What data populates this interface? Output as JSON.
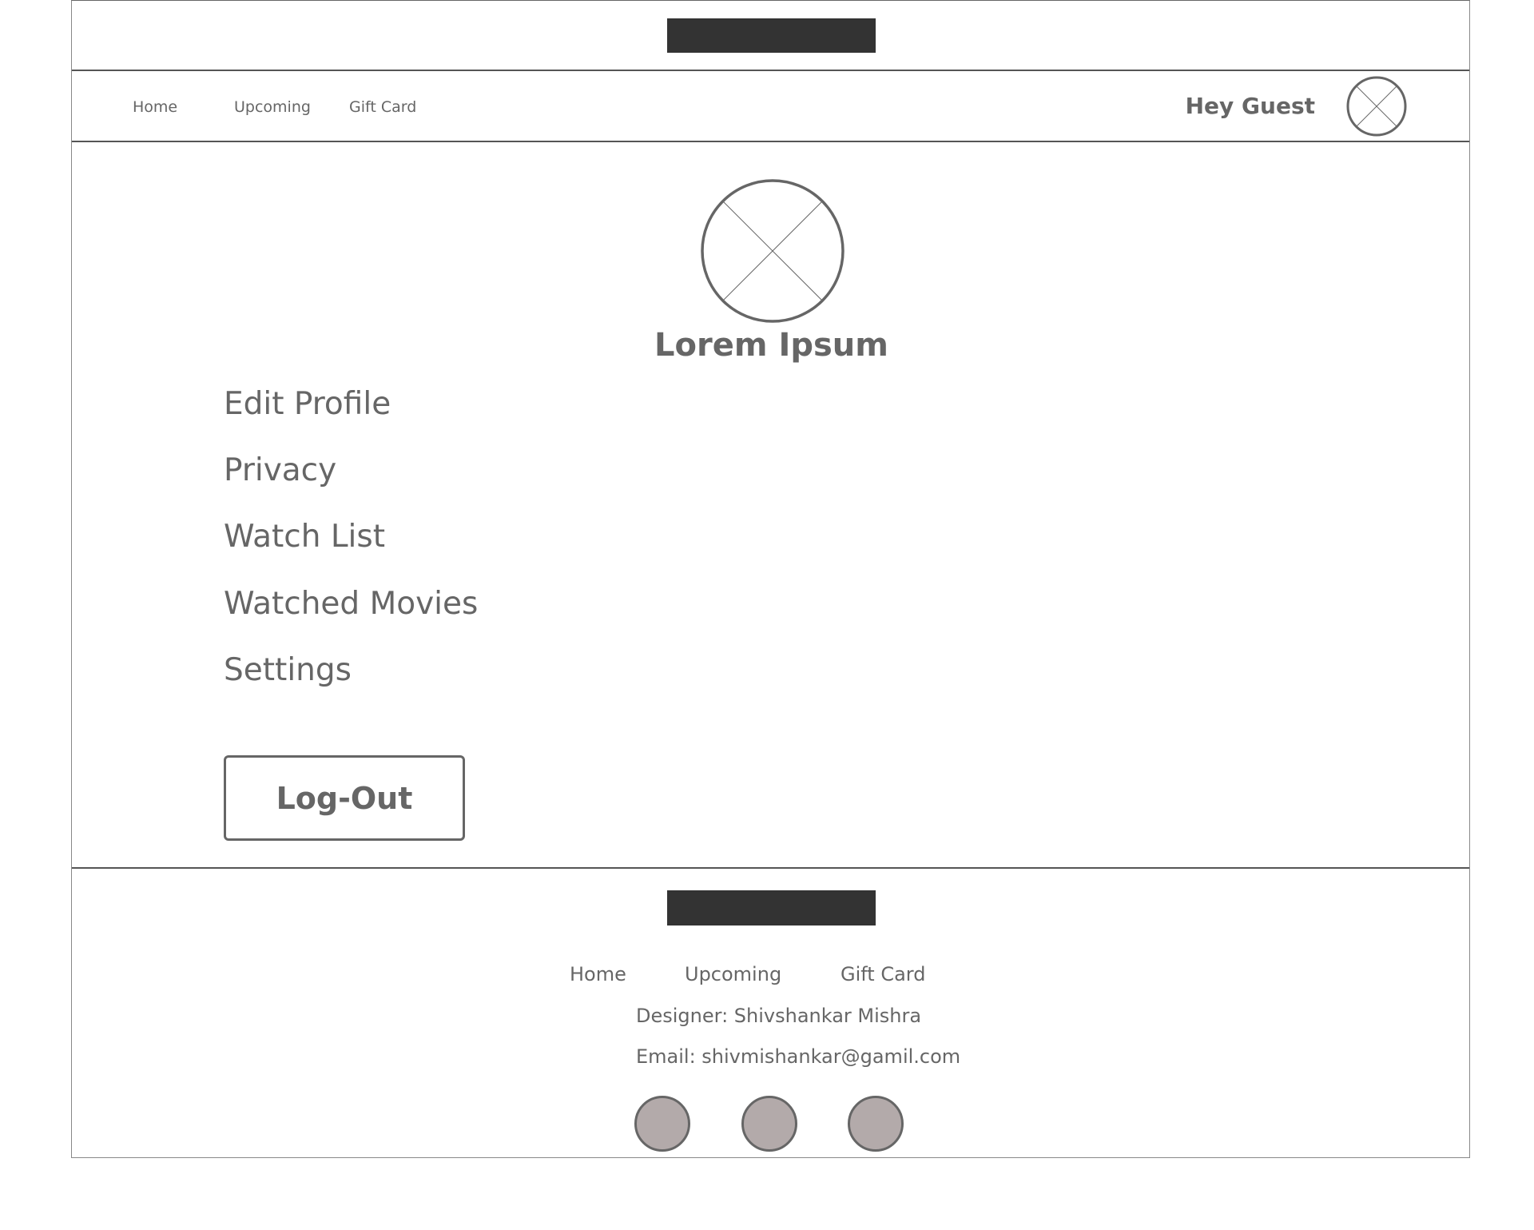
{
  "header": {
    "logo_name": "logo-placeholder"
  },
  "nav": {
    "links": [
      "Home",
      "Upcoming",
      "Gift Card"
    ],
    "greeting": "Hey Guest",
    "avatar_icon": "image-placeholder-icon"
  },
  "profile": {
    "avatar_icon": "image-placeholder-icon",
    "name": "Lorem Ipsum",
    "menu": [
      "Edit Profile",
      "Privacy",
      "Watch List",
      "Watched Movies",
      "Settings"
    ],
    "logout_label": "Log-Out"
  },
  "footer": {
    "logo_name": "logo-placeholder",
    "links": [
      "Home",
      "Upcoming",
      "Gift Card"
    ],
    "designer": "Designer: Shivshankar Mishra",
    "email": "Email: shivmishankar@gamil.com",
    "social_icons": [
      "social-icon",
      "social-icon",
      "social-icon"
    ]
  },
  "colors": {
    "text": "#666666",
    "logo_fill": "#333333",
    "social_fill": "#b3aaaa",
    "border": "#555555"
  }
}
